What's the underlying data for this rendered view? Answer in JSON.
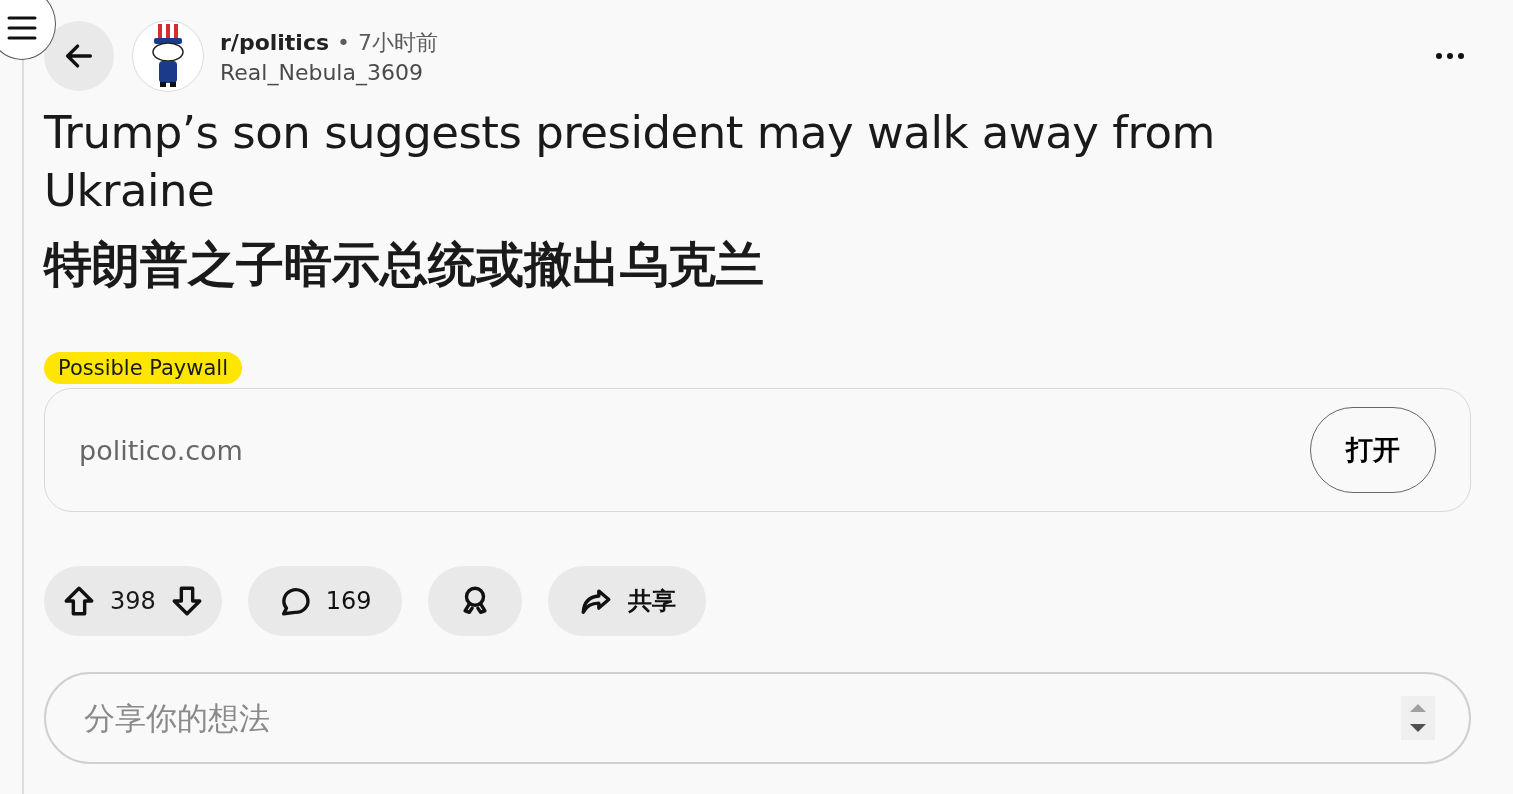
{
  "post": {
    "subreddit": "r/politics",
    "separator": "•",
    "time": "7小时前",
    "author": "Real_Nebula_3609",
    "title": "Trump’s son suggests president may walk away from Ukraine",
    "title_translation": "特朗普之子暗示总统或撤出乌克兰",
    "flair": "Possible Paywall"
  },
  "link": {
    "domain": "politico.com",
    "open_button": "打开"
  },
  "actions": [
    {
      "kind": "vote",
      "score": "398"
    },
    {
      "kind": "comments",
      "count": "169"
    },
    {
      "kind": "award"
    },
    {
      "kind": "share",
      "label": "共享"
    }
  ],
  "comment_box": {
    "placeholder": "分享你的想法"
  }
}
